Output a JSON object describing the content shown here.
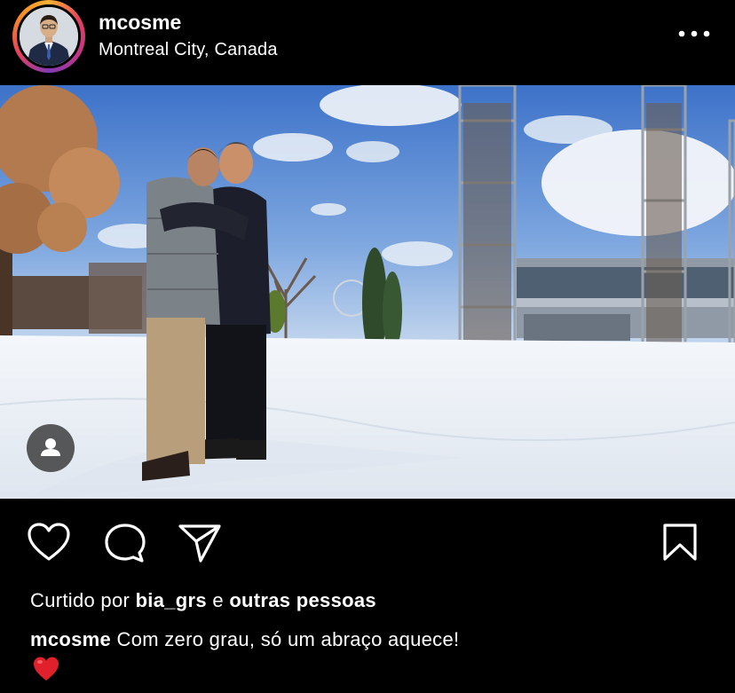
{
  "post": {
    "username": "mcosme",
    "location": "Montreal City, Canada"
  },
  "likes": {
    "prefix": "Curtido por",
    "user": "bia_grs",
    "connector": "e",
    "others": "outras pessoas"
  },
  "caption": {
    "user": "mcosme",
    "text": "Com zero grau, só um abraço aquece!",
    "emoji": "heart-emoji"
  },
  "colors": {
    "background": "#000000",
    "text": "#ffffff",
    "heart": "#e0202a"
  }
}
